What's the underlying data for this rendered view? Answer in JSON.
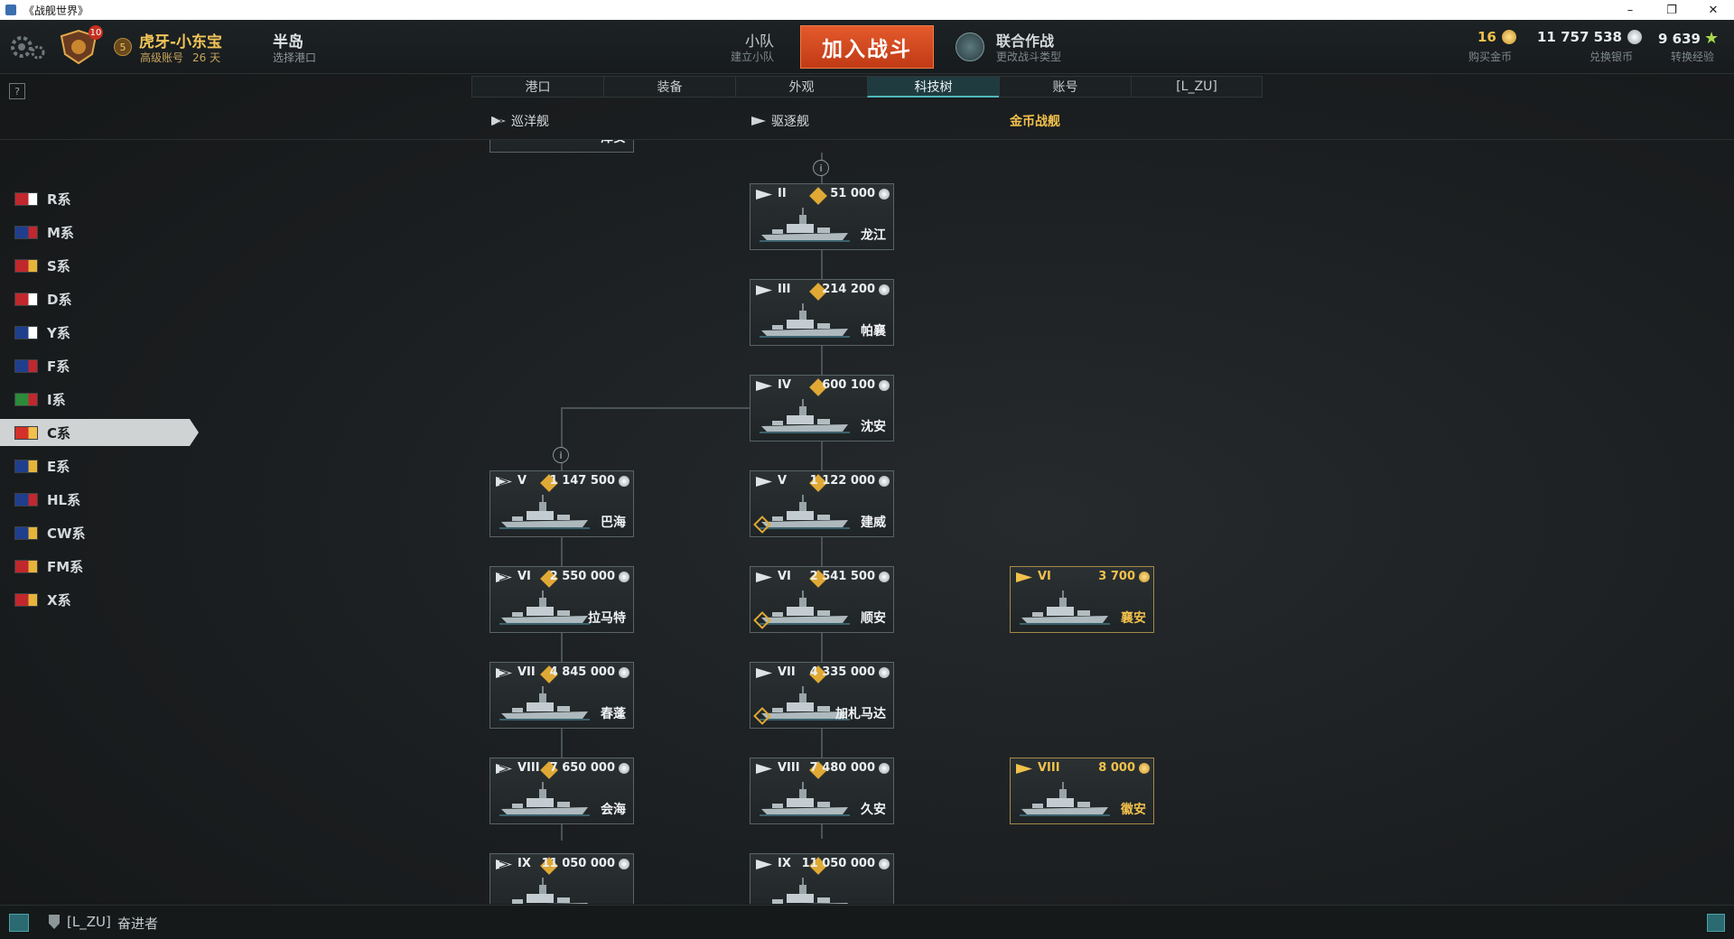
{
  "window": {
    "title": "《战舰世界》",
    "controls": [
      "–",
      "❐",
      "✕"
    ]
  },
  "header": {
    "rank_badge": "10",
    "level_badge": "5",
    "player_name": "虎牙-小东宝",
    "account_type": "高级账号",
    "account_days": "26 天",
    "port_name": "半岛",
    "port_sub": "选择港口",
    "squad_label": "小队",
    "squad_sub": "建立小队",
    "battle_button": "加入战斗",
    "operation_label": "联合作战",
    "operation_sub": "更改战斗类型",
    "doubloons": {
      "value": "16",
      "label": "购买金币"
    },
    "credits": {
      "value": "11 757 538",
      "label": "兑换银币"
    },
    "free_xp": {
      "value": "9 639",
      "label": "转换经验"
    }
  },
  "help_label": "?",
  "tabs": [
    {
      "label": "港口",
      "active": false
    },
    {
      "label": "装备",
      "active": false
    },
    {
      "label": "外观",
      "active": false
    },
    {
      "label": "科技树",
      "active": true
    },
    {
      "label": "账号",
      "active": false
    },
    {
      "label": "[L_ZU]",
      "active": false
    }
  ],
  "class_filters": [
    {
      "label": "巡洋舰",
      "style": "normal"
    },
    {
      "label": "驱逐舰",
      "style": "normal"
    },
    {
      "label": "金币战舰",
      "style": "gold"
    }
  ],
  "nations": [
    {
      "label": "R系",
      "active": false,
      "colors": [
        "#c0282d",
        "#ffffff"
      ]
    },
    {
      "label": "M系",
      "active": false,
      "colors": [
        "#1f3f8c",
        "#c0282d"
      ]
    },
    {
      "label": "S系",
      "active": false,
      "colors": [
        "#c0282d",
        "#e7b43a"
      ]
    },
    {
      "label": "D系",
      "active": false,
      "colors": [
        "#c0282d",
        "#ffffff"
      ]
    },
    {
      "label": "Y系",
      "active": false,
      "colors": [
        "#1f3f8c",
        "#ffffff"
      ]
    },
    {
      "label": "F系",
      "active": false,
      "colors": [
        "#1f3f8c",
        "#c0282d"
      ]
    },
    {
      "label": "I系",
      "active": false,
      "colors": [
        "#2d8a3a",
        "#c0282d"
      ]
    },
    {
      "label": "C系",
      "active": true,
      "colors": [
        "#d3312a",
        "#f2c14b"
      ]
    },
    {
      "label": "E系",
      "active": false,
      "colors": [
        "#1f3f8c",
        "#e7b43a"
      ]
    },
    {
      "label": "HL系",
      "active": false,
      "colors": [
        "#1f3f8c",
        "#c0282d"
      ]
    },
    {
      "label": "CW系",
      "active": false,
      "colors": [
        "#1f3f8c",
        "#e7b43a"
      ]
    },
    {
      "label": "FM系",
      "active": false,
      "colors": [
        "#c0282d",
        "#e7b43a"
      ]
    },
    {
      "label": "X系",
      "active": false,
      "colors": [
        "#c0282d",
        "#e7b43a"
      ]
    }
  ],
  "tree": {
    "partial_top_name": "泽安",
    "cards": [
      {
        "id": "longjiang",
        "tier": "II",
        "price": "51 000",
        "name": "龙江",
        "type": "destroyer",
        "currency": "silver",
        "premium": false,
        "upgrade": false
      },
      {
        "id": "phra-ruang",
        "tier": "III",
        "price": "214 200",
        "name": "帕襄",
        "type": "destroyer",
        "currency": "silver",
        "premium": false,
        "upgrade": false
      },
      {
        "id": "shen-an",
        "tier": "IV",
        "price": "600 100",
        "name": "沈安",
        "type": "destroyer",
        "currency": "silver",
        "premium": false,
        "upgrade": false
      },
      {
        "id": "jianwei",
        "tier": "V",
        "price": "1 122 000",
        "name": "建威",
        "type": "destroyer",
        "currency": "silver",
        "premium": false,
        "upgrade": true
      },
      {
        "id": "bahai",
        "tier": "V",
        "price": "1 147 500",
        "name": "巴海",
        "type": "cruiser",
        "currency": "silver",
        "premium": false,
        "upgrade": false
      },
      {
        "id": "lamatt",
        "tier": "VI",
        "price": "2 550 000",
        "name": "拉马特",
        "type": "cruiser",
        "currency": "silver",
        "premium": false,
        "upgrade": false
      },
      {
        "id": "shunan",
        "tier": "VI",
        "price": "2 541 500",
        "name": "顺安",
        "type": "destroyer",
        "currency": "silver",
        "premium": false,
        "upgrade": true
      },
      {
        "id": "xiangan",
        "tier": "VI",
        "price": "3 700",
        "name": "襄安",
        "type": "destroyer",
        "currency": "gold",
        "premium": true,
        "upgrade": false
      },
      {
        "id": "chunpeng",
        "tier": "VII",
        "price": "4 845 000",
        "name": "春蓬",
        "type": "cruiser",
        "currency": "silver",
        "premium": false,
        "upgrade": false
      },
      {
        "id": "gajah-mada",
        "tier": "VII",
        "price": "4 335 000",
        "name": "加札马达",
        "type": "destroyer",
        "currency": "silver",
        "premium": false,
        "upgrade": true
      },
      {
        "id": "huihai",
        "tier": "VIII",
        "price": "7 650 000",
        "name": "会海",
        "type": "cruiser",
        "currency": "silver",
        "premium": false,
        "upgrade": false
      },
      {
        "id": "jiuan",
        "tier": "VIII",
        "price": "7 480 000",
        "name": "久安",
        "type": "destroyer",
        "currency": "silver",
        "premium": false,
        "upgrade": false
      },
      {
        "id": "huian",
        "tier": "VIII",
        "price": "8 000",
        "name": "徽安",
        "type": "destroyer",
        "currency": "gold",
        "premium": true,
        "upgrade": false
      },
      {
        "id": "cruiser-ix",
        "tier": "IX",
        "price": "11 050 000",
        "name": "",
        "type": "cruiser",
        "currency": "silver",
        "premium": false,
        "upgrade": false
      },
      {
        "id": "destroyer-ix",
        "tier": "IX",
        "price": "11 050 000",
        "name": "",
        "type": "destroyer",
        "currency": "silver",
        "premium": false,
        "upgrade": false
      }
    ]
  },
  "footer": {
    "clan_tag": "[L_ZU]",
    "clan_name": "奋进者"
  }
}
